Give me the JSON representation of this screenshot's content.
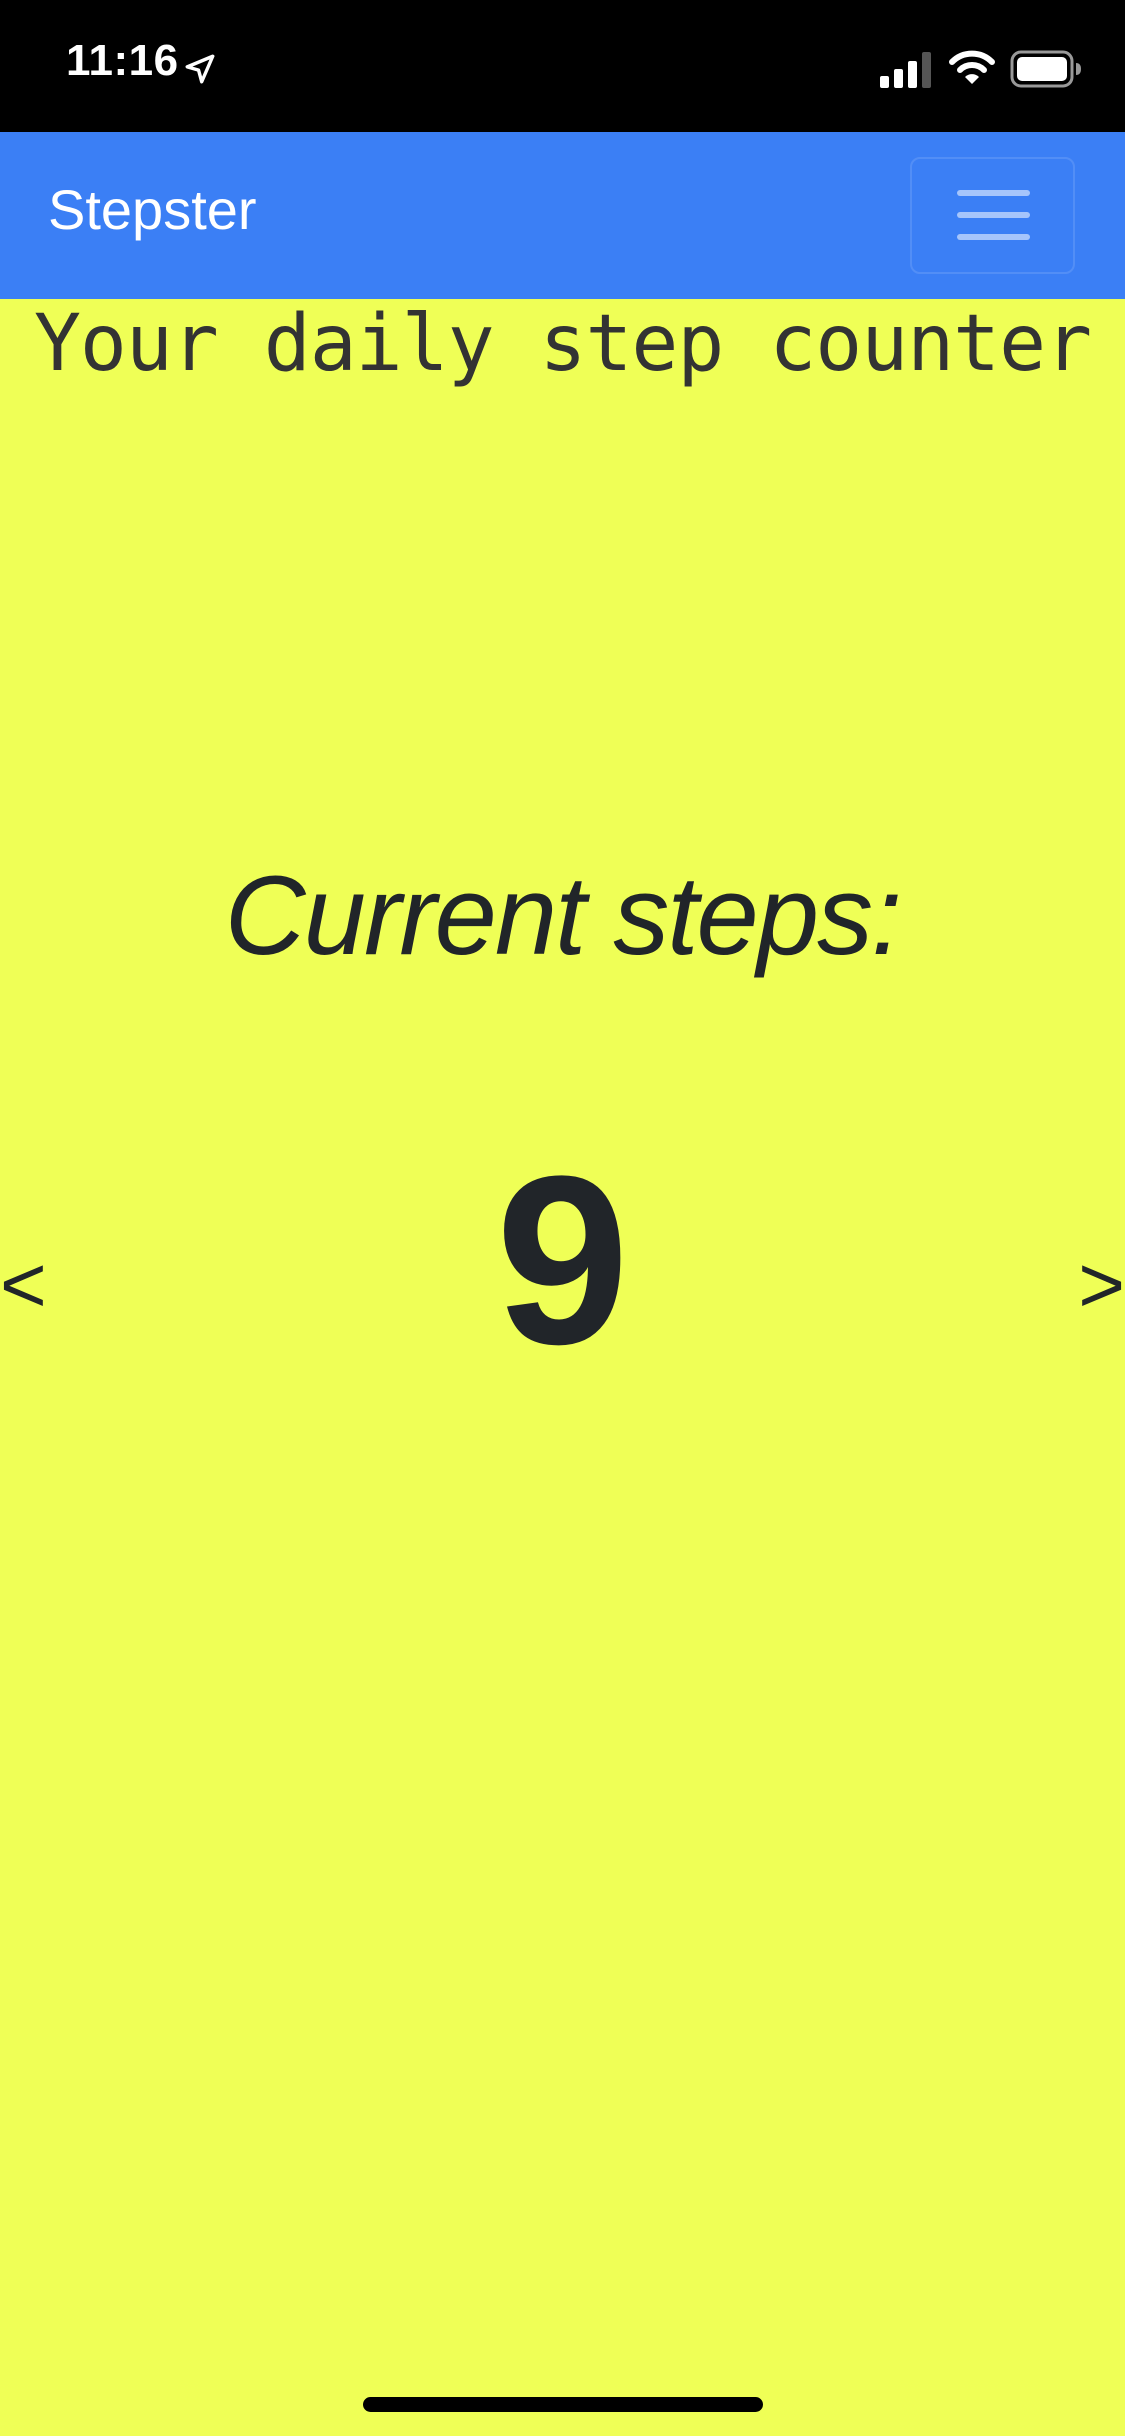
{
  "status_bar": {
    "time": "11:16",
    "icons": [
      "location-arrow-icon",
      "signal-icon",
      "wifi-icon",
      "battery-icon"
    ]
  },
  "navbar": {
    "brand": "Stepster",
    "menu_icon": "hamburger-menu-icon",
    "background_color": "#3B7FF5"
  },
  "main": {
    "tagline": "Your daily step counter",
    "steps_label": "Current steps:",
    "steps_value": "9",
    "prev_label": "<",
    "next_label": ">",
    "background_color": "#EFFF56"
  }
}
